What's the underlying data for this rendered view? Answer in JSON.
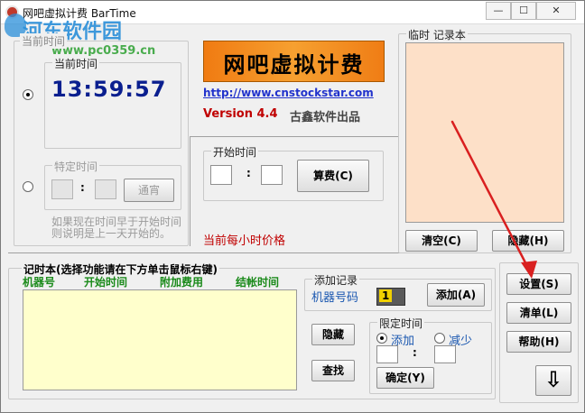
{
  "window": {
    "title": "网吧虚拟计费  BarTime",
    "minimize": "—",
    "maximize": "☐",
    "close": "✕"
  },
  "watermark": {
    "site_name": "河东软件园",
    "site_url": "www.pc0359.cn"
  },
  "time_panel": {
    "group_label": "当前时间",
    "group_label_partial": "当前时间",
    "current_time_label": "当前时间",
    "current_time_value": "13:59:57",
    "specific_time_label": "特定时间",
    "specific_colon": ":",
    "dawn_button": "通宵",
    "hint_line1": "如果现在时间早于开始时间",
    "hint_line2": "则说明是上一天开始的。"
  },
  "brand": {
    "logo_text": "网吧虚拟计费",
    "url": "http://www.cnstockstar.com",
    "version": "Version 4.4",
    "vendor": "古鑫软件出品"
  },
  "start_time": {
    "label": "开始时间",
    "colon": ":",
    "calc_button": "算费(C)"
  },
  "price_label": "当前每小时价格",
  "notepad": {
    "label": "临时 记录本",
    "clear_button": "清空(C)",
    "hide_button": "隐藏(H)"
  },
  "records": {
    "group_label": "记时本(选择功能请在下方单击鼠标右键)",
    "columns": [
      "机器号",
      "开始时间",
      "附加费用",
      "结帐时间"
    ],
    "hide_button": "隐藏",
    "find_button": "查找"
  },
  "add_record": {
    "label": "添加记录",
    "machine_label": "机器号码",
    "machine_value": "1",
    "add_button": "添加(A)"
  },
  "limit_time": {
    "label": "限定时间",
    "add_radio": "添加",
    "reduce_radio": "减少",
    "colon": ":",
    "confirm_button": "确定(Y)"
  },
  "side_buttons": {
    "settings": "设置(S)",
    "clear_list": "清单(L)",
    "help": "帮助(H)",
    "down_arrow": "⇩"
  },
  "colors": {
    "time_blue": "#0a1f8f",
    "url_blue": "#2233cc",
    "version_red": "#c00000",
    "column_green": "#1a8a1a",
    "notepad_bg": "#fde0c8",
    "records_bg": "#ffffcc",
    "arrow_red": "#d92020"
  }
}
